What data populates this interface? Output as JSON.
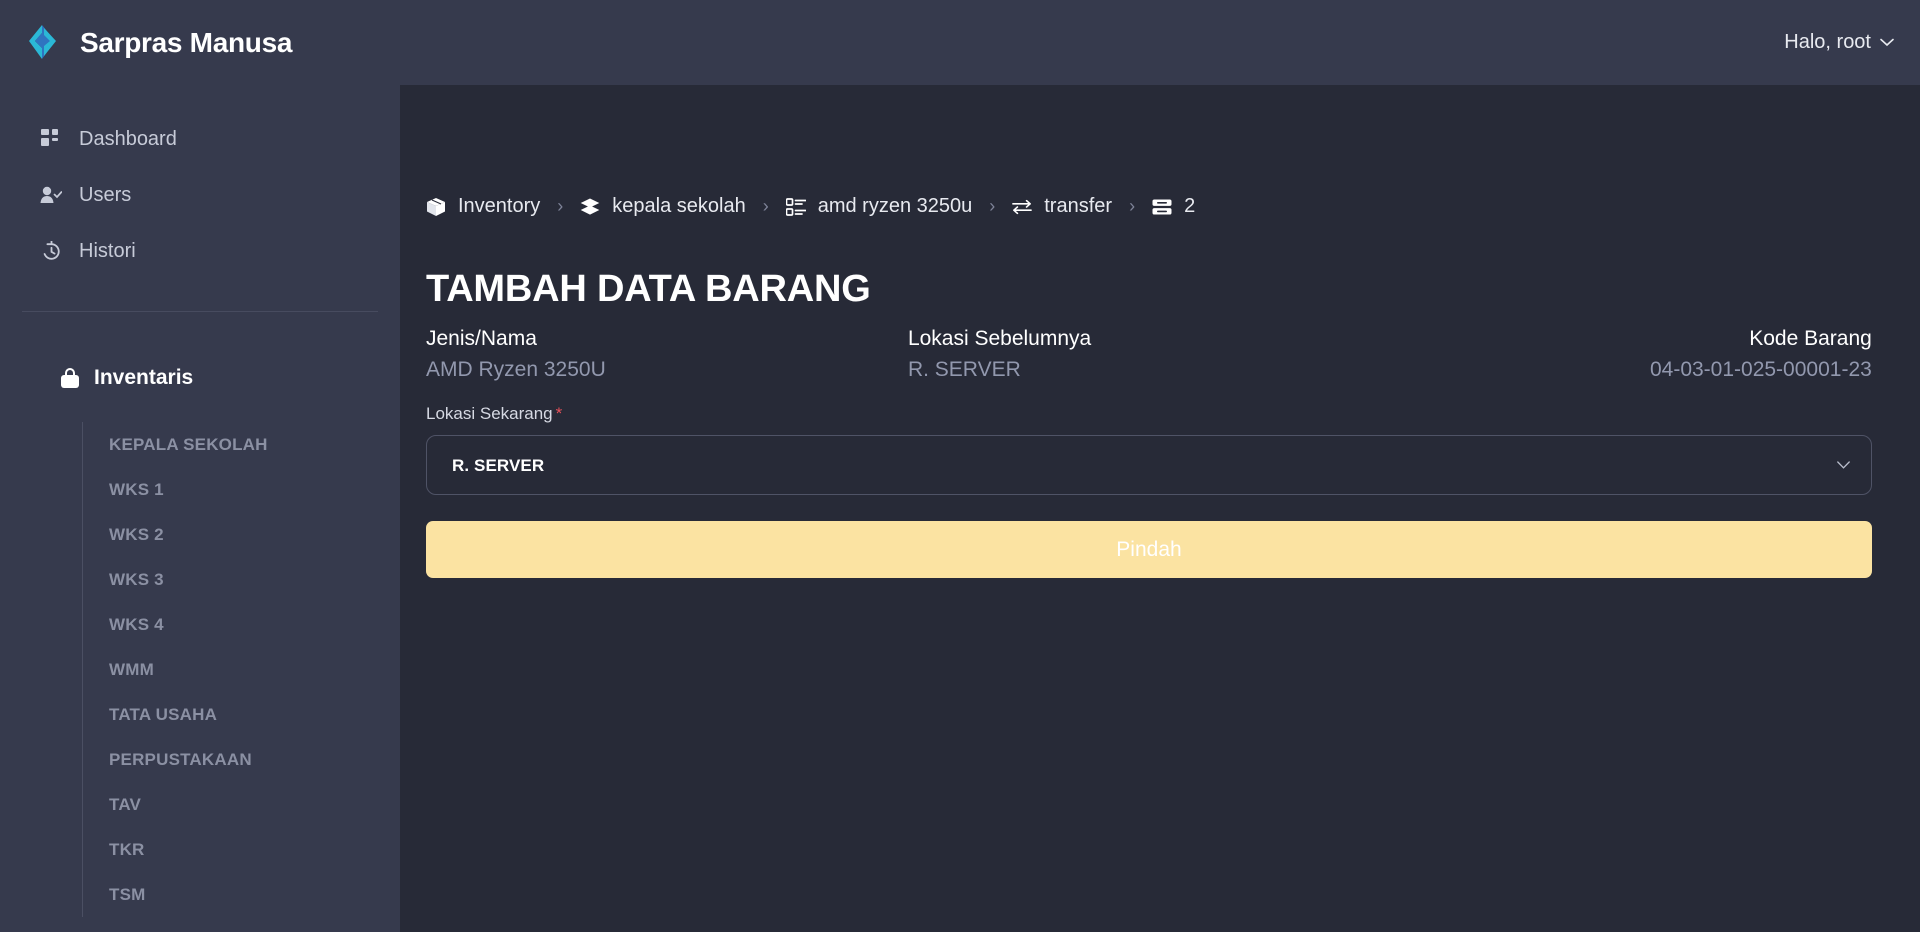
{
  "brand": {
    "name": "Sarpras Manusa",
    "logo_icon": "code-diamond-logo",
    "logo_colors": [
      "#2bb8d6",
      "#2f74c0"
    ]
  },
  "topbar": {
    "user_greeting": "Halo, root",
    "user_chevron_icon": "chevron-down-icon"
  },
  "sidebar": {
    "nav": [
      {
        "label": "Dashboard",
        "icon": "grid-dashboard-icon"
      },
      {
        "label": "Users",
        "icon": "user-check-icon"
      },
      {
        "label": "Histori",
        "icon": "history-clock-icon"
      }
    ],
    "inventory_group": {
      "label": "Inventaris",
      "icon": "bag-icon",
      "items": [
        {
          "label": "KEPALA SEKOLAH"
        },
        {
          "label": "WKS 1"
        },
        {
          "label": "WKS 2"
        },
        {
          "label": "WKS 3"
        },
        {
          "label": "WKS 4"
        },
        {
          "label": "WMM"
        },
        {
          "label": "TATA USAHA"
        },
        {
          "label": "PERPUSTAKAAN"
        },
        {
          "label": "TAV"
        },
        {
          "label": "TKR"
        },
        {
          "label": "TSM"
        }
      ]
    }
  },
  "breadcrumb": [
    {
      "label": "Inventory",
      "icon": "box-package-icon"
    },
    {
      "label": "kepala sekolah",
      "icon": "layers-stack-icon"
    },
    {
      "label": "amd ryzen 3250u",
      "icon": "list-detail-icon"
    },
    {
      "label": "transfer",
      "icon": "transfer-arrows-icon"
    },
    {
      "label": "2",
      "icon": "database-rows-icon"
    }
  ],
  "breadcrumb_separator": "›",
  "main": {
    "page_title": "TAMBAH DATA BARANG",
    "info": [
      {
        "label": "Jenis/Nama",
        "value": "AMD Ryzen 3250U"
      },
      {
        "label": "Lokasi Sebelumnya",
        "value": "R. SERVER"
      },
      {
        "label": "Kode Barang",
        "value": "04-03-01-025-00001-23"
      }
    ],
    "form": {
      "location_label": "Lokasi Sekarang",
      "required_marker": "*",
      "location_selected": "R. SERVER",
      "location_options": [
        "R. SERVER"
      ],
      "select_arrow_icon": "chevron-down-icon",
      "submit_label": "Pindah",
      "submit_color": "#fbe3a2"
    }
  },
  "theme": {
    "sidebar_bg": "#363a4d",
    "main_bg": "#272a37",
    "accent": "#fbe3a2",
    "required_red": "#e8515a"
  }
}
